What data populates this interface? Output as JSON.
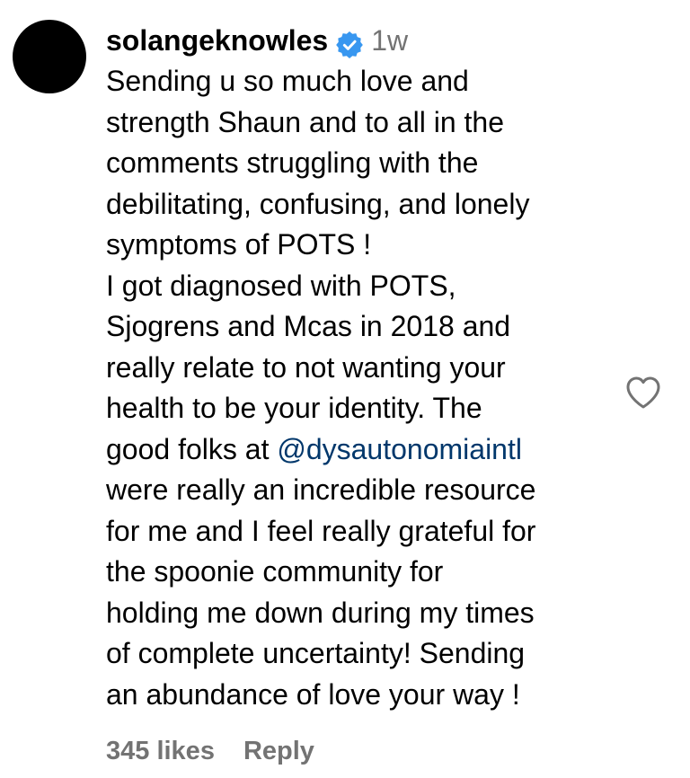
{
  "comment": {
    "username": "solangeknowles",
    "verified_icon": "verified-badge-icon",
    "timestamp": "1w",
    "text_part1": "Sending u so much love and\nstrength Shaun and to all in the\ncomments struggling with the\ndebilitating, confusing, and lonely\nsymptoms of POTS !\nI got diagnosed with POTS,\nSjogrens and Mcas in 2018 and\nreally relate to not wanting your\nhealth to be your identity. The\ngood folks at ",
    "mention": "@dysautonomiaintl",
    "text_part2": "\nwere really an incredible resource\nfor me and I feel really grateful for\nthe spoonie community for\nholding me down during my times\nof complete uncertainty! Sending\nan abundance of love your way !",
    "likes": "345 likes",
    "reply_label": "Reply",
    "like_icon": "heart-outline-icon"
  },
  "colors": {
    "verified_blue": "#3897f0",
    "secondary_text": "#737373",
    "mention_blue": "#00376b"
  }
}
